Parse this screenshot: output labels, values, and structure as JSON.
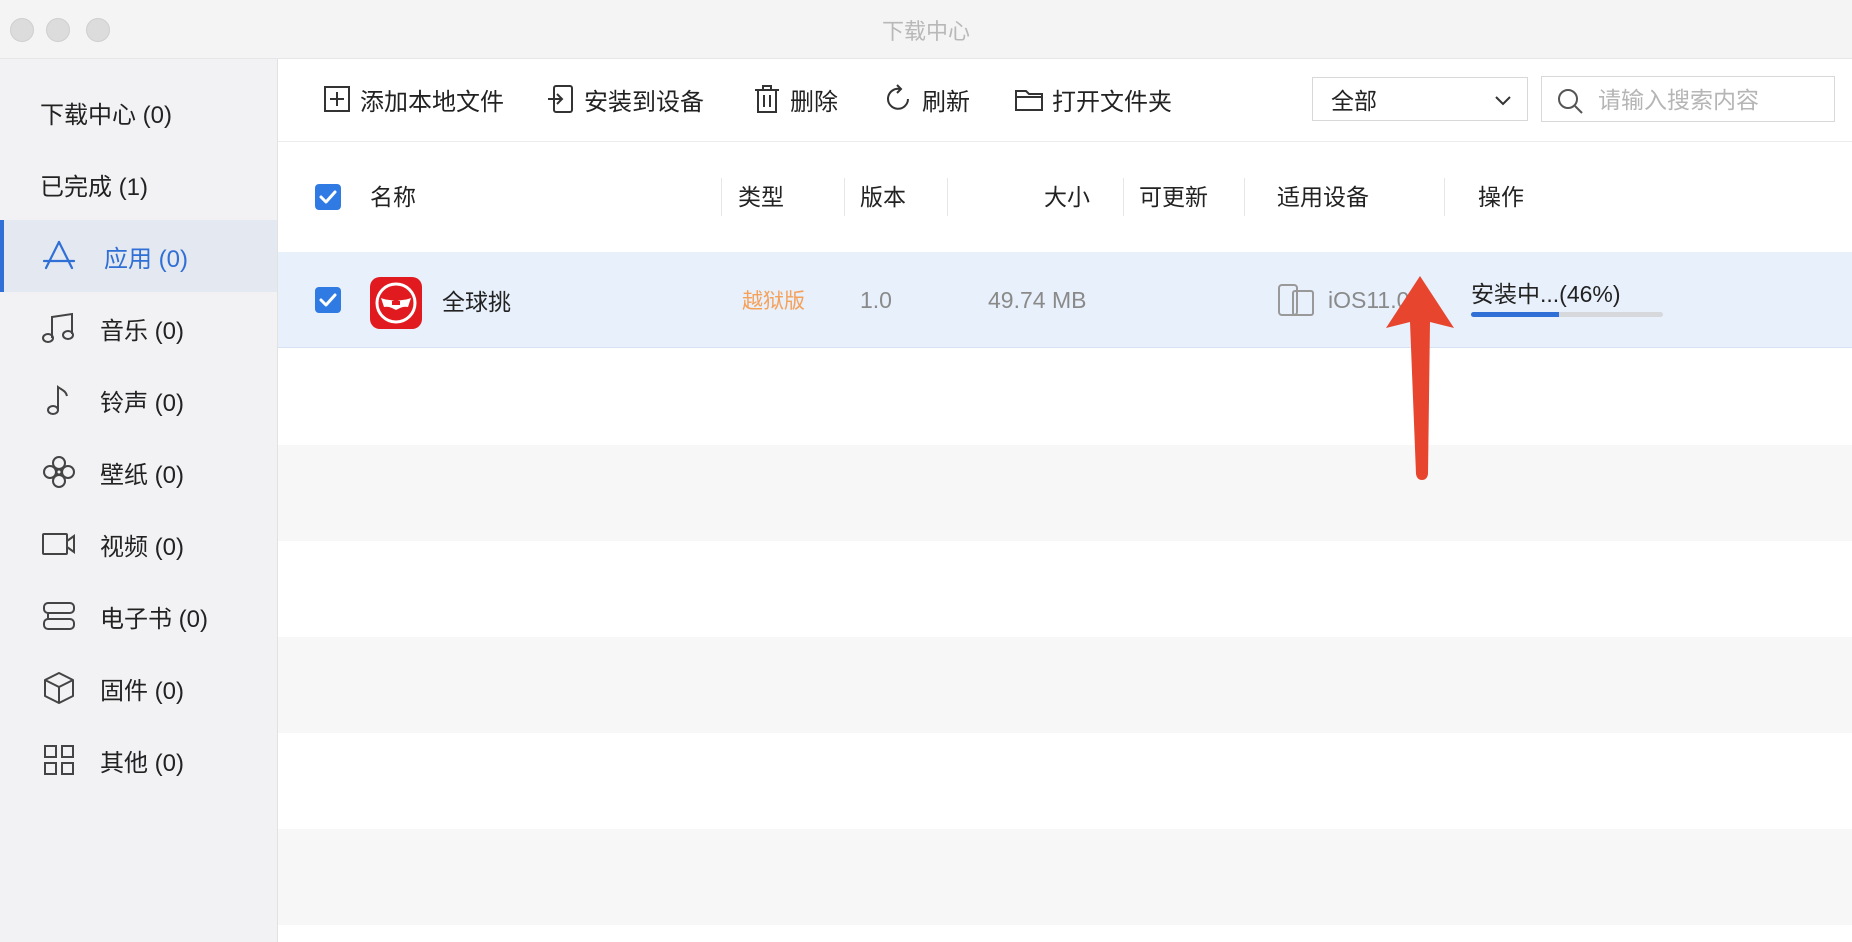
{
  "window": {
    "title": "下载中心"
  },
  "sidebar": {
    "items": [
      {
        "label": "下载中心 (0)"
      },
      {
        "label": "已完成 (1)"
      },
      {
        "label": "应用 (0)",
        "icon": "app-store-icon",
        "active": true
      },
      {
        "label": "音乐 (0)",
        "icon": "music-icon"
      },
      {
        "label": "铃声 (0)",
        "icon": "ringtone-icon"
      },
      {
        "label": "壁纸 (0)",
        "icon": "wallpaper-icon"
      },
      {
        "label": "视频 (0)",
        "icon": "video-icon"
      },
      {
        "label": "电子书 (0)",
        "icon": "ebook-icon"
      },
      {
        "label": "固件 (0)",
        "icon": "firmware-icon"
      },
      {
        "label": "其他 (0)",
        "icon": "other-icon"
      }
    ]
  },
  "toolbar": {
    "add_local_file": "添加本地文件",
    "install_to_device": "安装到设备",
    "delete": "删除",
    "refresh": "刷新",
    "open_folder": "打开文件夹",
    "filter_value": "全部",
    "search_placeholder": "请输入搜索内容"
  },
  "table": {
    "headers": {
      "name": "名称",
      "type": "类型",
      "version": "版本",
      "size": "大小",
      "updatable": "可更新",
      "device": "适用设备",
      "action": "操作"
    },
    "rows": [
      {
        "name": "全球挑",
        "type": "越狱版",
        "version": "1.0",
        "size": "49.74 MB",
        "updatable": "",
        "device": "iOS11.0+",
        "status": "安装中...(46%)",
        "progress": 0.46,
        "checked": true
      }
    ]
  },
  "colors": {
    "accent": "#2f6fd6",
    "type_tag": "#f5a15a",
    "app_icon_bg": "#e01a1f",
    "annotation_arrow": "#e8452f"
  }
}
